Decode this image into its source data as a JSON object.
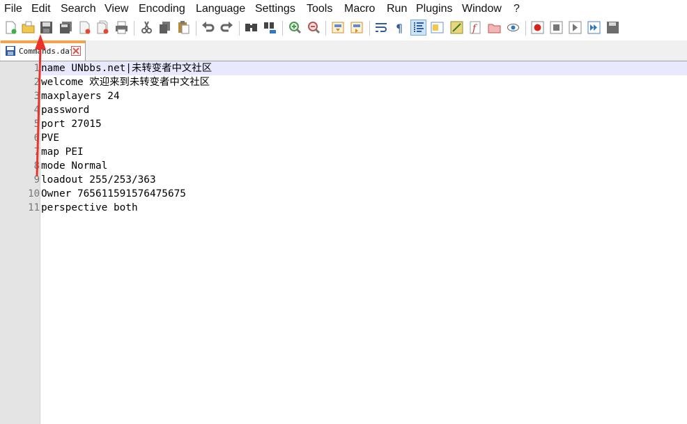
{
  "menu": [
    "File",
    "Edit",
    "Search",
    "View",
    "Encoding",
    "Language",
    "Settings",
    "Tools",
    "Macro",
    "Run",
    "Plugins",
    "Window",
    "?"
  ],
  "toolbar": {
    "icons": [
      "new-file-icon",
      "open-file-icon",
      "save-icon",
      "save-all-icon",
      "close-icon",
      "close-all-icon",
      "print-icon",
      "cut-icon",
      "copy-icon",
      "paste-icon",
      "undo-icon",
      "redo-icon",
      "find-icon",
      "replace-icon",
      "zoom-in-icon",
      "zoom-out-icon",
      "sync-vertical-icon",
      "sync-horizontal-icon",
      "word-wrap-icon",
      "show-all-chars-icon",
      "indent-guide-icon",
      "doc-map-icon",
      "function-list-icon",
      "folder-workspace-icon",
      "folder-icon",
      "monitor-icon",
      "record-macro-icon",
      "stop-record-icon",
      "play-macro-icon",
      "run-macro-multiple-icon",
      "save-macro-icon"
    ]
  },
  "tab": {
    "label": "Commands.dat",
    "accent_color": "#f7a246"
  },
  "editor": {
    "lines": [
      {
        "num": "1",
        "text": "name UNbbs.net|未转变者中文社区"
      },
      {
        "num": "2",
        "text": "welcome 欢迎来到未转变者中文社区"
      },
      {
        "num": "3",
        "text": "maxplayers 24"
      },
      {
        "num": "4",
        "text": "password"
      },
      {
        "num": "5",
        "text": "port 27015"
      },
      {
        "num": "6",
        "text": "PVE"
      },
      {
        "num": "7",
        "text": "map PEI"
      },
      {
        "num": "8",
        "text": "mode Normal"
      },
      {
        "num": "9",
        "text": "loadout 255/253/363"
      },
      {
        "num": "10",
        "text": "Owner 765611591576475675"
      },
      {
        "num": "11",
        "text": "perspective both"
      }
    ]
  },
  "annotation": {
    "arrow_color": "#e8322b"
  }
}
